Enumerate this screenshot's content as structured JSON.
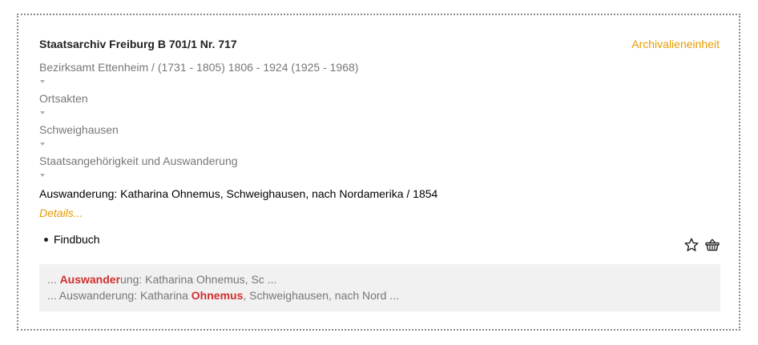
{
  "record": {
    "title": "Staatsarchiv Freiburg B 701/1 Nr. 717",
    "type_label": "Archivalieneinheit",
    "breadcrumbs": [
      "Bezirksamt Ettenheim / (1731 - 1805) 1806 - 1924 (1925 - 1968)",
      "Ortsakten",
      "Schweighausen",
      "Staatsangehörigkeit und Auswanderung"
    ],
    "record_title": "Auswanderung: Katharina Ohnemus, Schweighausen, nach Nordamerika / 1854",
    "details_label": "Details...",
    "findbuch_label": "Findbuch"
  },
  "icons": {
    "favorite": "star-outline-icon",
    "basket": "shopping-basket-icon"
  },
  "snippets": [
    {
      "prefix": "... ",
      "highlight": "Auswander",
      "suffix": "ung: Katharina Ohnemus, Sc ..."
    },
    {
      "prefix": "... Auswanderung: Katharina ",
      "highlight": "Ohnemus",
      "suffix": ", Schweighausen, nach Nord ..."
    }
  ],
  "colors": {
    "accent": "#e79b00",
    "highlight": "#d32f2f",
    "muted_text": "#777777",
    "snippet_bg": "#f1f1f1",
    "border": "#8a8a8a"
  }
}
